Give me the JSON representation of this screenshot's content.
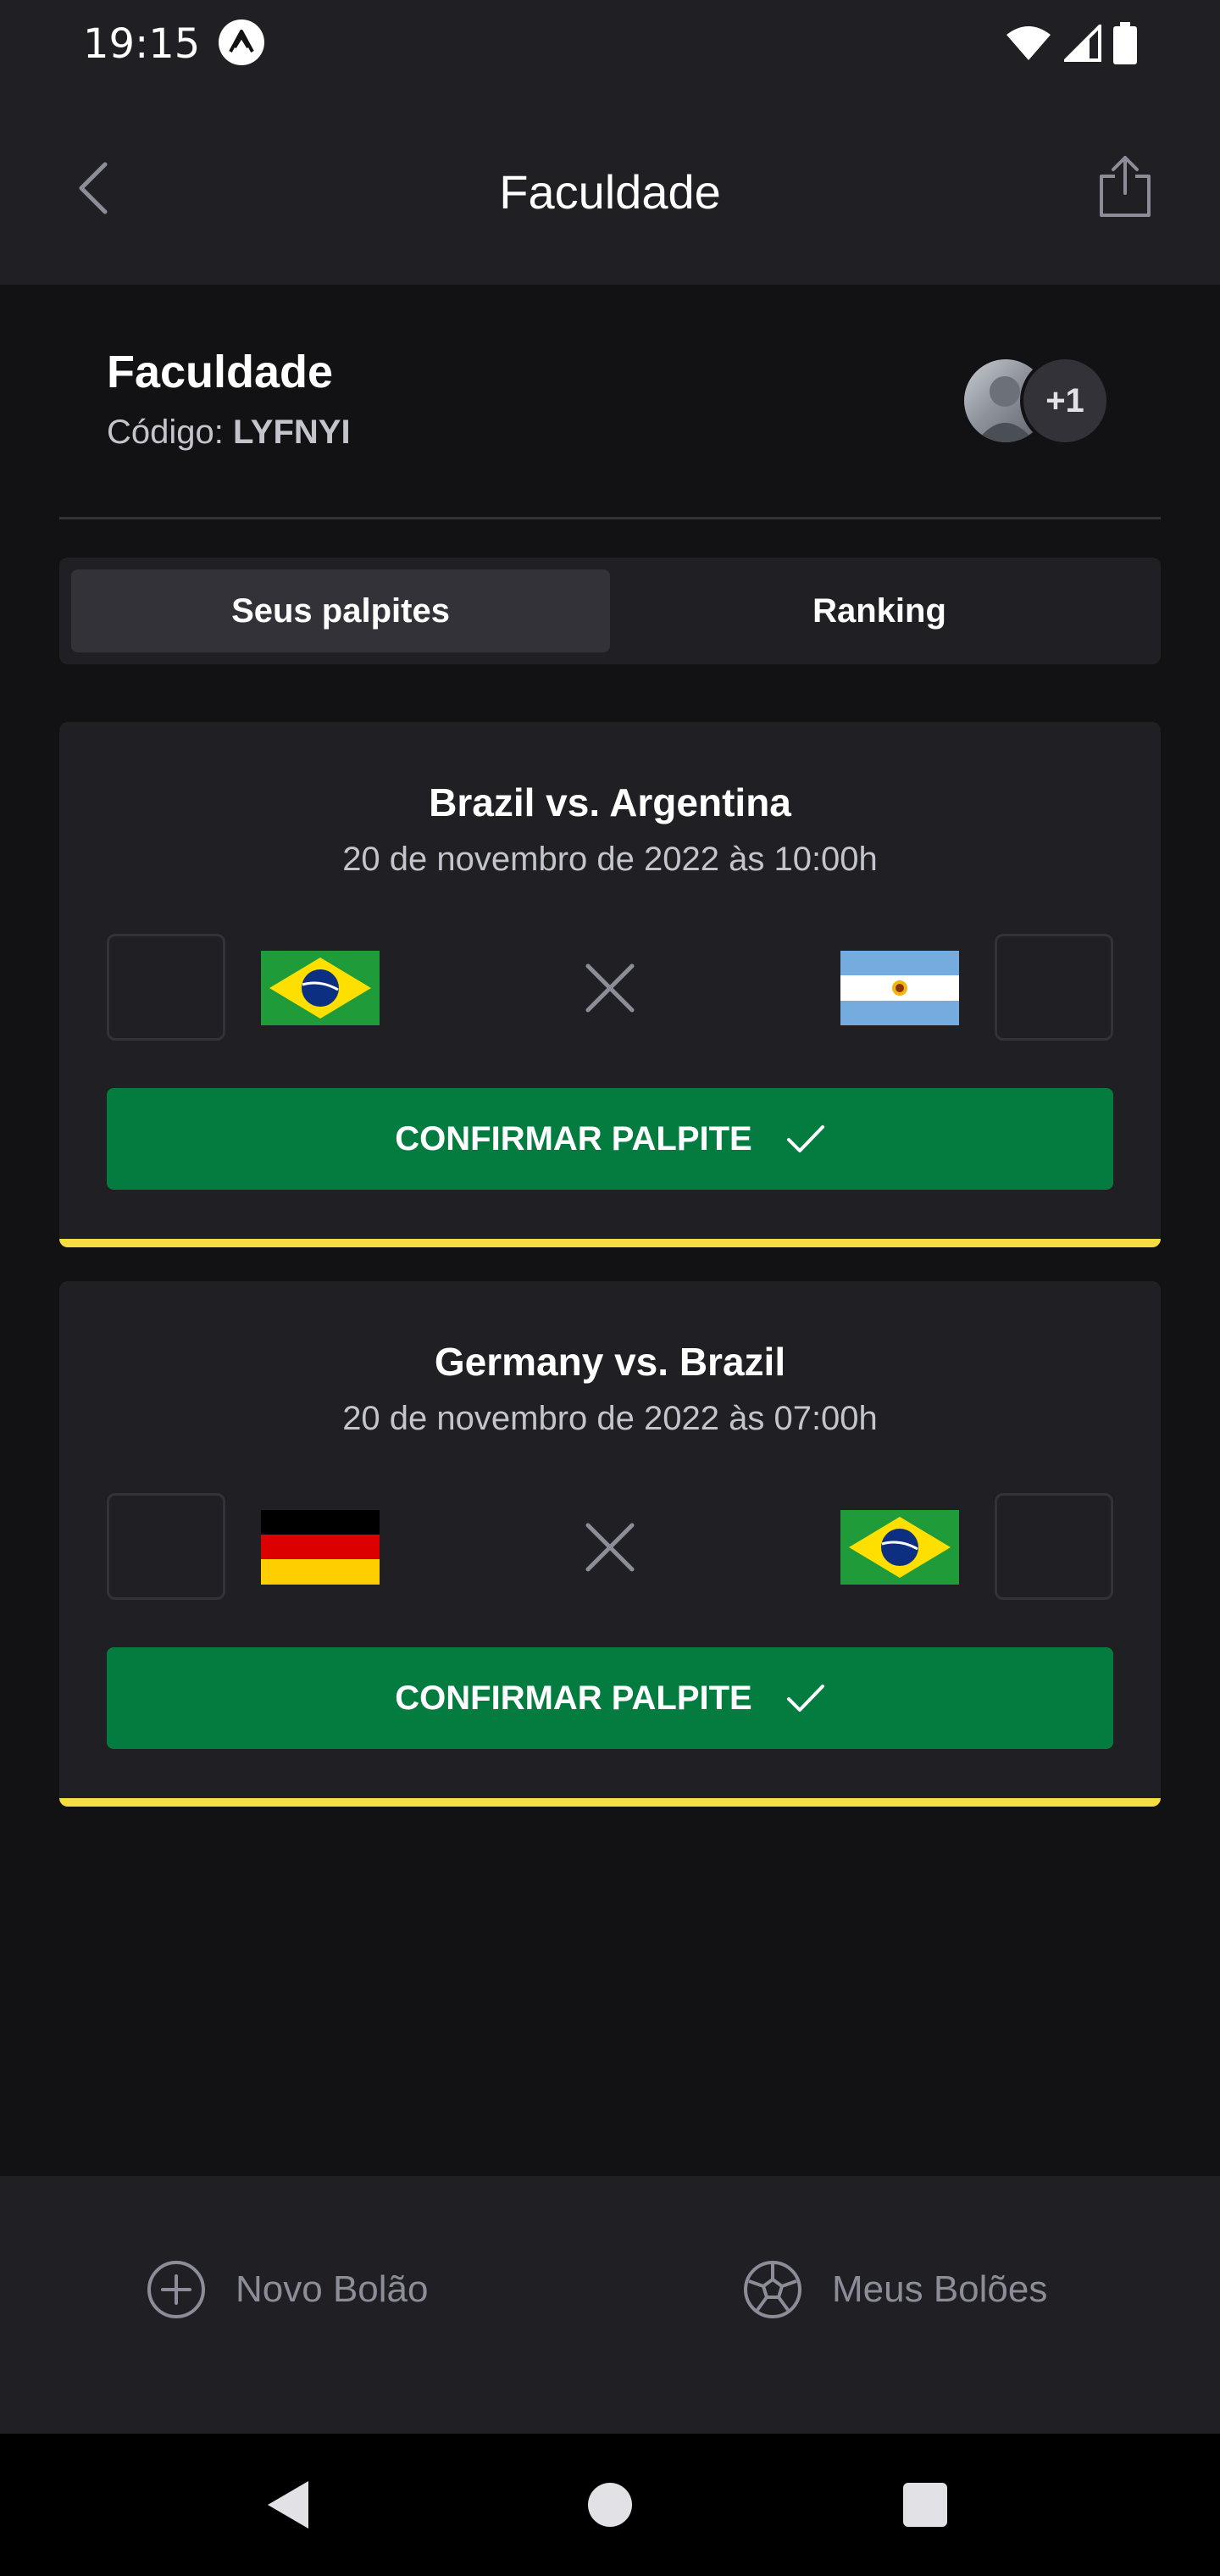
{
  "status_bar": {
    "time": "19:15"
  },
  "header": {
    "title": "Faculdade"
  },
  "pool": {
    "name": "Faculdade",
    "code_label": "Código:",
    "code": "LYFNYI",
    "extra_participants": "+1"
  },
  "tabs": [
    {
      "label": "Seus palpites",
      "active": true
    },
    {
      "label": "Ranking",
      "active": false
    }
  ],
  "games": [
    {
      "title": "Brazil vs. Argentina",
      "date": "20 de novembro de 2022 às 10:00h",
      "home_flag": "brazil-flag",
      "away_flag": "argentina-flag",
      "home_score": "",
      "away_score": "",
      "confirm_label": "CONFIRMAR PALPITE"
    },
    {
      "title": "Germany vs. Brazil",
      "date": "20 de novembro de 2022 às 07:00h",
      "home_flag": "germany-flag",
      "away_flag": "brazil-flag",
      "home_score": "",
      "away_score": "",
      "confirm_label": "CONFIRMAR PALPITE"
    }
  ],
  "bottom_nav": {
    "new_pool": "Novo Bolão",
    "my_pools": "Meus Bolões"
  },
  "colors": {
    "background": "#121214",
    "surface": "#202024",
    "accent_yellow": "#f7dd43",
    "confirm_green": "#047c3f"
  }
}
